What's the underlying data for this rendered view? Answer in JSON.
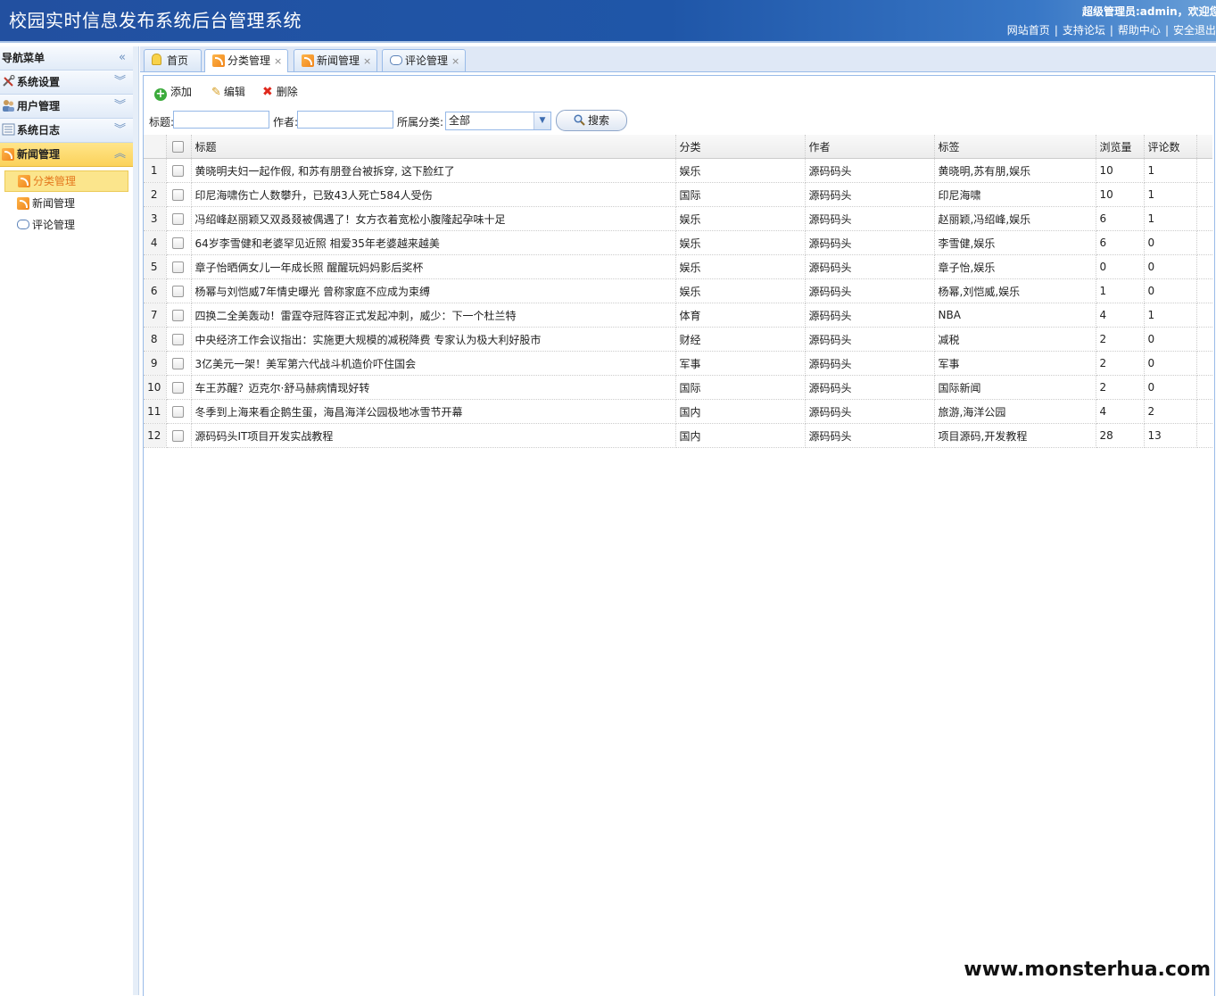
{
  "header": {
    "title": "校园实时信息发布系统后台管理系统",
    "welcome": "超级管理员:admin，欢迎您",
    "links": [
      "网站首页",
      "支持论坛",
      "帮助中心",
      "安全退出"
    ]
  },
  "sidebar": {
    "title": "导航菜单",
    "sections": [
      {
        "label": "系统设置",
        "icon": "tools-icon"
      },
      {
        "label": "用户管理",
        "icon": "users-icon"
      },
      {
        "label": "系统日志",
        "icon": "log-icon"
      },
      {
        "label": "新闻管理",
        "icon": "rss-icon"
      }
    ],
    "news_items": [
      {
        "label": "分类管理",
        "icon": "rss-icon"
      },
      {
        "label": "新闻管理",
        "icon": "rss-icon"
      },
      {
        "label": "评论管理",
        "icon": "comment-icon"
      }
    ]
  },
  "tabs": [
    {
      "label": "首页",
      "icon": "bulb-icon",
      "closable": false
    },
    {
      "label": "分类管理",
      "icon": "rss-icon",
      "closable": true,
      "active": true
    },
    {
      "label": "新闻管理",
      "icon": "rss-icon",
      "closable": true
    },
    {
      "label": "评论管理",
      "icon": "comment-icon",
      "closable": true
    }
  ],
  "toolbar": {
    "add": "添加",
    "edit": "编辑",
    "delete": "删除"
  },
  "search": {
    "title_label": "标题:",
    "author_label": "作者:",
    "category_label": "所属分类:",
    "category_value": "全部",
    "button": "搜索"
  },
  "grid": {
    "columns": [
      "标题",
      "分类",
      "作者",
      "标签",
      "浏览量",
      "评论数"
    ],
    "rows": [
      {
        "n": "1",
        "title": "黄晓明夫妇一起作假, 和苏有朋登台被拆穿, 这下脸红了",
        "category": "娱乐",
        "author": "源码码头",
        "tags": "黄晓明,苏有朋,娱乐",
        "views": "10",
        "comments": "1"
      },
      {
        "n": "2",
        "title": "印尼海啸伤亡人数攀升，已致43人死亡584人受伤",
        "category": "国际",
        "author": "源码码头",
        "tags": "印尼海啸",
        "views": "10",
        "comments": "1"
      },
      {
        "n": "3",
        "title": "冯绍峰赵丽颖又双叒叕被偶遇了！女方衣着宽松小腹隆起孕味十足",
        "category": "娱乐",
        "author": "源码码头",
        "tags": "赵丽颖,冯绍峰,娱乐",
        "views": "6",
        "comments": "1"
      },
      {
        "n": "4",
        "title": "64岁李雪健和老婆罕见近照 相爱35年老婆越来越美",
        "category": "娱乐",
        "author": "源码码头",
        "tags": "李雪健,娱乐",
        "views": "6",
        "comments": "0"
      },
      {
        "n": "5",
        "title": "章子怡晒俩女儿一年成长照 醒醒玩妈妈影后奖杯",
        "category": "娱乐",
        "author": "源码码头",
        "tags": "章子怡,娱乐",
        "views": "0",
        "comments": "0"
      },
      {
        "n": "6",
        "title": "杨幂与刘恺威7年情史曝光 曾称家庭不应成为束缚",
        "category": "娱乐",
        "author": "源码码头",
        "tags": "杨幂,刘恺威,娱乐",
        "views": "1",
        "comments": "0"
      },
      {
        "n": "7",
        "title": "四换二全美轰动！雷霆夺冠阵容正式发起冲刺，威少：下一个杜兰特",
        "category": "体育",
        "author": "源码码头",
        "tags": "NBA",
        "views": "4",
        "comments": "1"
      },
      {
        "n": "8",
        "title": "中央经济工作会议指出：实施更大规模的减税降费 专家认为极大利好股市",
        "category": "财经",
        "author": "源码码头",
        "tags": "减税",
        "views": "2",
        "comments": "0"
      },
      {
        "n": "9",
        "title": "3亿美元一架！美军第六代战斗机造价吓住国会",
        "category": "军事",
        "author": "源码码头",
        "tags": "军事",
        "views": "2",
        "comments": "0"
      },
      {
        "n": "10",
        "title": "车王苏醒？迈克尔·舒马赫病情现好转",
        "category": "国际",
        "author": "源码码头",
        "tags": "国际新闻",
        "views": "2",
        "comments": "0"
      },
      {
        "n": "11",
        "title": "冬季到上海来看企鹅生蛋，海昌海洋公园极地冰雪节开幕",
        "category": "国内",
        "author": "源码码头",
        "tags": "旅游,海洋公园",
        "views": "4",
        "comments": "2"
      },
      {
        "n": "12",
        "title": "源码码头IT项目开发实战教程",
        "category": "国内",
        "author": "源码码头",
        "tags": "项目源码,开发教程",
        "views": "28",
        "comments": "13"
      }
    ]
  },
  "watermark": "www.monsterhua.com"
}
